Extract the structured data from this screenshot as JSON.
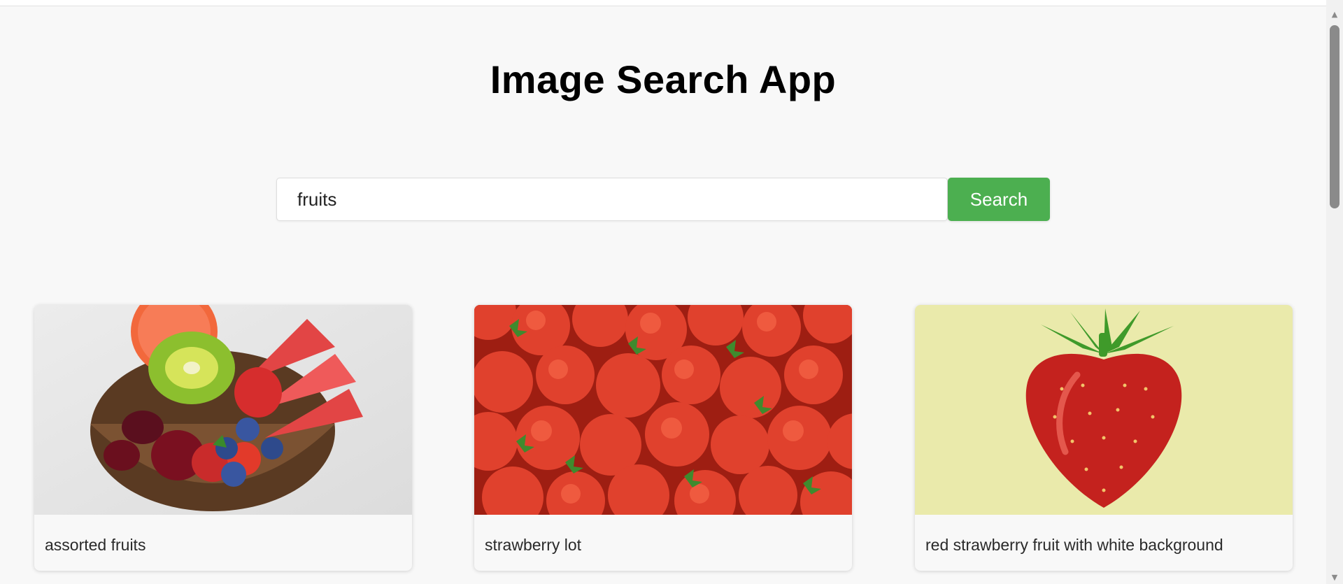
{
  "app": {
    "title": "Image Search App"
  },
  "search": {
    "value": "fruits",
    "button_label": "Search"
  },
  "results": [
    {
      "caption": "assorted fruits",
      "icon": "fruit-bowl-photo"
    },
    {
      "caption": "strawberry lot",
      "icon": "strawberries-photo"
    },
    {
      "caption": "red strawberry fruit with white background",
      "icon": "single-strawberry-photo"
    }
  ],
  "colors": {
    "accent": "#4caf50",
    "background": "#f8f8f8"
  }
}
